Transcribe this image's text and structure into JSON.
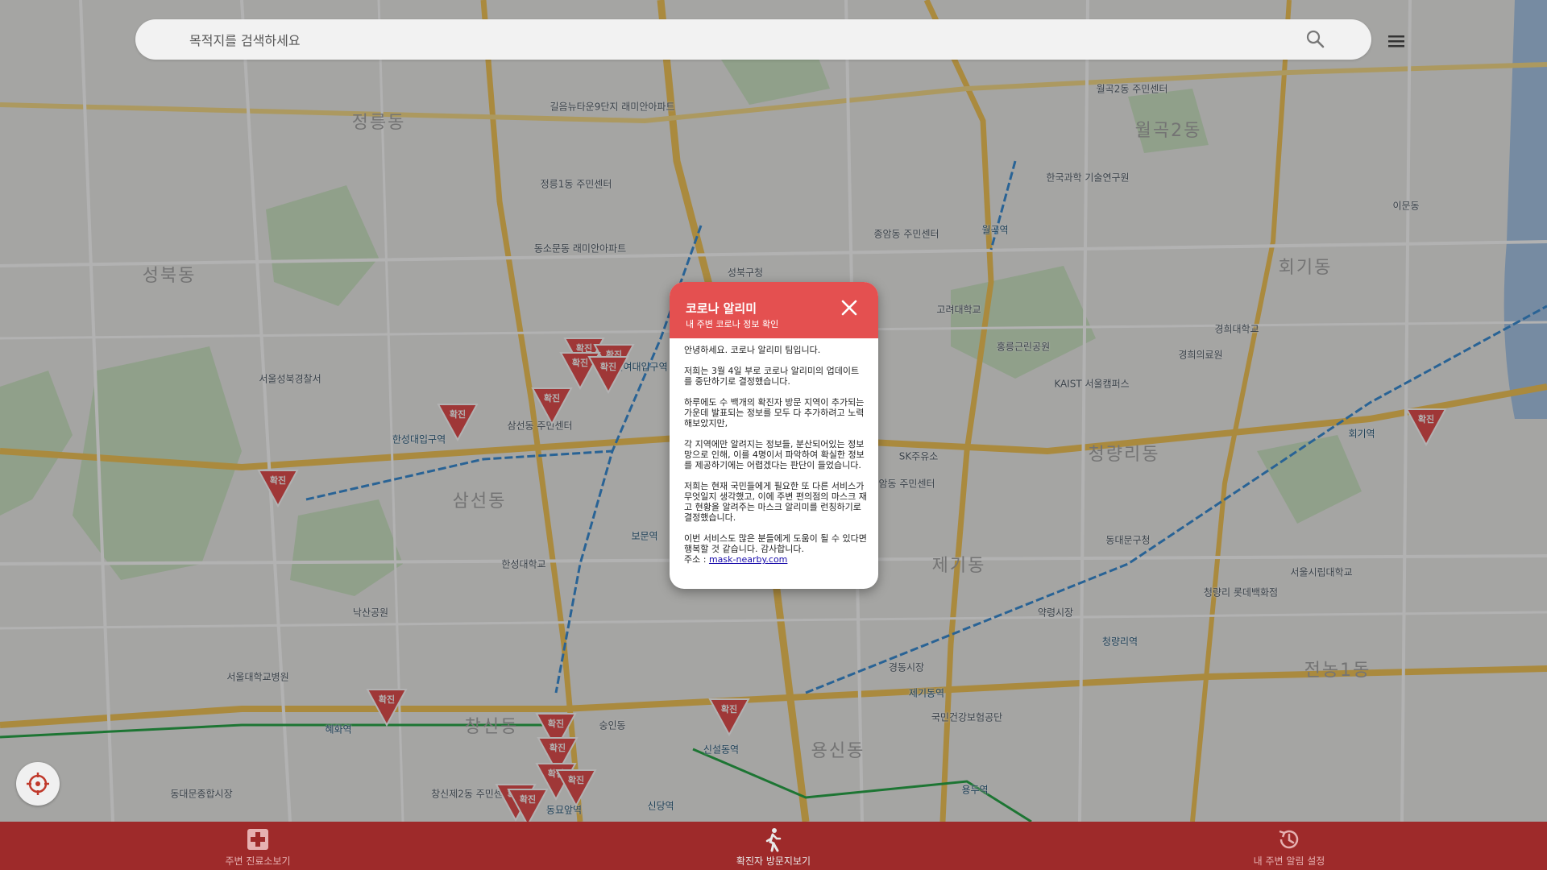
{
  "search": {
    "placeholder": "목적지를 검색하세요"
  },
  "icons": {
    "search": "search-icon",
    "menu": "hamburger-menu-icon",
    "locate": "crosshair-location-icon",
    "close": "close-icon"
  },
  "colors": {
    "modal_header": "#e45050",
    "marker": "#e45050",
    "bottom_nav": "#9e2a2a"
  },
  "modal": {
    "title": "코로나 알리미",
    "subtitle": "내 주변 코로나 정보 확인",
    "paragraphs": [
      "안녕하세요. 코로나 알리미 팀입니다.",
      "저희는 3월 4일 부로 코로나 알리미의 업데이트를 중단하기로 결정했습니다.",
      "하루에도 수 백개의 확진자 방문 지역이 추가되는 가운데 발표되는 정보를 모두 다 추가하려고 노력해보았지만,",
      "각 지역에만 알려지는 정보들, 분산되어있는 정보망으로 인해, 이를 4명이서 파악하여 확실한 정보를 제공하기에는 어렵겠다는 판단이 들었습니다.",
      "저희는 현재 국민들에게 필요한 또 다른 서비스가 무엇일지 생각했고, 이에 주변 편의점의 마스크 재고 현황을 알려주는 마스크 알리미를 런칭하기로 결정했습니다.",
      "이번 서비스도 많은 분들에게 도움이 될 수 있다면 행복할 것 같습니다. 감사합니다."
    ],
    "address_label": "주소 :",
    "address_link": "mask-nearby.com"
  },
  "bottom_nav": [
    {
      "label": "주변 진료소보기",
      "icon": "hospital-cross-icon"
    },
    {
      "label": "확진자 방문지보기",
      "icon": "walking-person-icon"
    },
    {
      "label": "내 주변 알림 설정",
      "icon": "location-history-icon"
    }
  ],
  "map": {
    "marker_label": "확진",
    "areas": [
      "성북동",
      "삼선동",
      "월곡2동",
      "청량리동",
      "제기동",
      "창신동",
      "정릉동",
      "용신동",
      "전농1동",
      "회기동"
    ],
    "labels": [
      "정릉1동 주민센터",
      "길음뉴타운9단지 래미안아파트",
      "월곡2동 주민센터",
      "동소문동 래미안아파트",
      "삼선동 주민센터",
      "안암동 주민센터",
      "고려대학교",
      "한국과학 기술연구원",
      "KAIST 서울캠퍼스",
      "경희대학교",
      "경희의료원",
      "청량리역",
      "제기동역",
      "용두역",
      "신설동역",
      "신당역",
      "보문역",
      "성신여대입구역",
      "한성대입구역",
      "창신제2동 주민센터",
      "동대문종합시장",
      "서울성북경찰서",
      "서울대학교병원",
      "국민건강보험공단",
      "SK주유소",
      "홍릉근린공원",
      "월곡역",
      "이문동",
      "회기역",
      "동대문구청",
      "청량리 롯데백화점",
      "서울시립대학교",
      "종암동 주민센터",
      "성북구청",
      "한성대학교",
      "혜화역",
      "낙산공원",
      "동묘앞역",
      "숭인동",
      "약령시장",
      "경동시장"
    ]
  }
}
